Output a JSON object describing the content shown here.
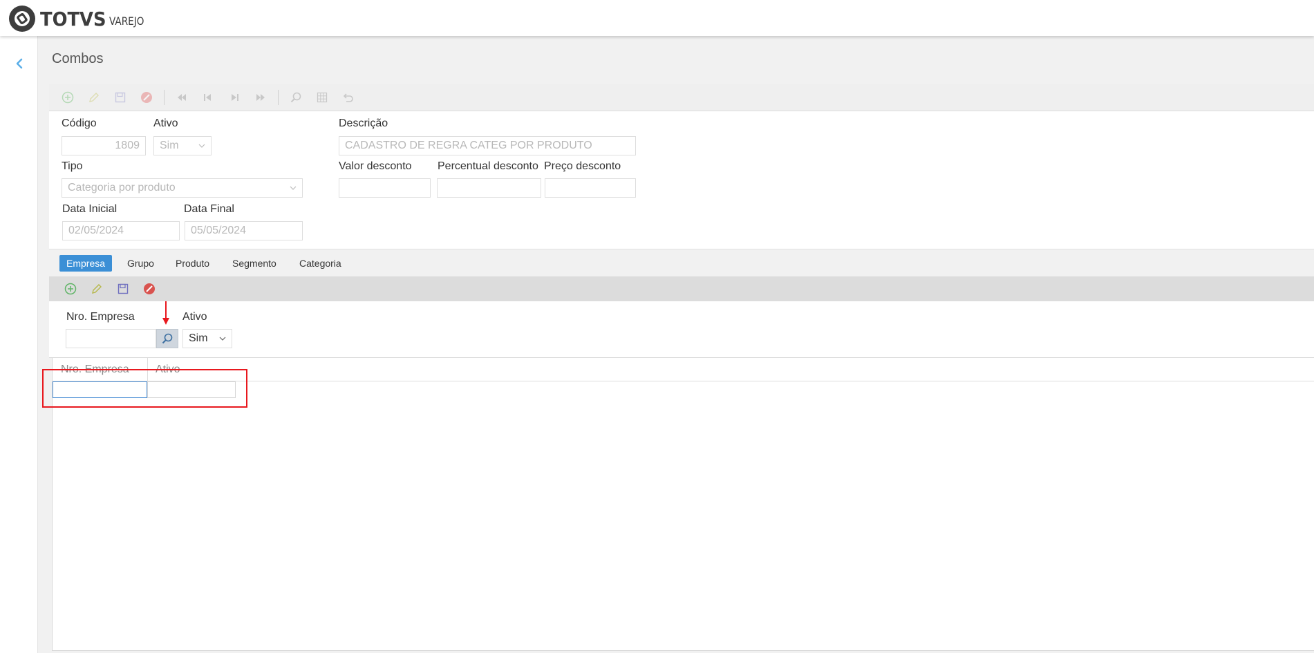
{
  "app": {
    "brand": "TOTVS",
    "product": "VAREJO"
  },
  "page": {
    "title": "Combos"
  },
  "form": {
    "codigo": {
      "label": "Código",
      "value": "1809"
    },
    "ativo": {
      "label": "Ativo",
      "value": "Sim"
    },
    "descricao": {
      "label": "Descrição",
      "value": "CADASTRO DE REGRA CATEG POR PRODUTO"
    },
    "tipo": {
      "label": "Tipo",
      "value": "Categoria por produto"
    },
    "valor_desconto": {
      "label": "Valor desconto",
      "value": ""
    },
    "percentual_desconto": {
      "label": "Percentual desconto",
      "value": ""
    },
    "preco_desconto": {
      "label": "Preço desconto",
      "value": ""
    },
    "data_inicial": {
      "label": "Data Inicial",
      "value": "02/05/2024"
    },
    "data_final": {
      "label": "Data Final",
      "value": "05/05/2024"
    }
  },
  "tabs": [
    "Empresa",
    "Grupo",
    "Produto",
    "Segmento",
    "Categoria"
  ],
  "active_tab": "Empresa",
  "detail": {
    "nro_empresa": {
      "label": "Nro. Empresa",
      "value": ""
    },
    "ativo": {
      "label": "Ativo",
      "value": "Sim"
    }
  },
  "grid": {
    "columns": [
      "Nro. Empresa",
      "Ativo"
    ]
  },
  "colors": {
    "accent": "#3b8fd6",
    "highlight": "#e8181e"
  },
  "icons": {
    "toolbar": [
      "add-icon",
      "edit-icon",
      "save-icon",
      "cancel-icon",
      "first-icon",
      "previous-icon",
      "next-icon",
      "last-icon",
      "search-icon",
      "grid-icon",
      "undo-icon"
    ],
    "subtoolbar": [
      "add-icon",
      "edit-icon",
      "save-icon",
      "cancel-icon"
    ]
  }
}
